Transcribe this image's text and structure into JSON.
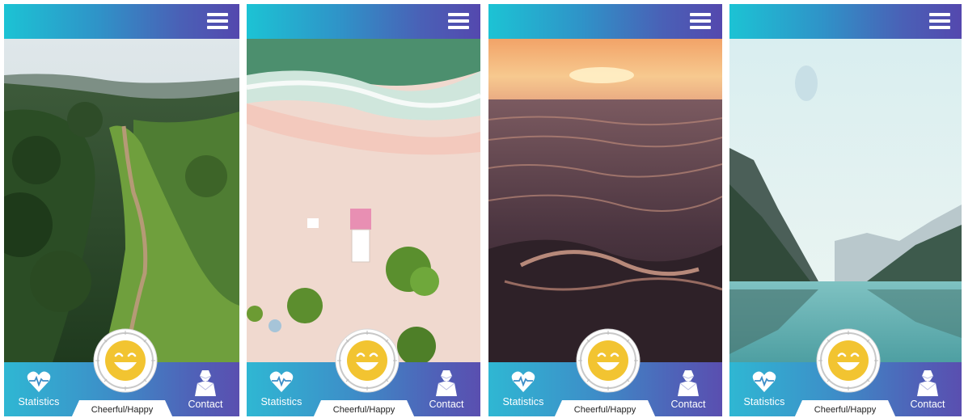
{
  "app": {
    "accent_gradient": [
      "#1cc3d4",
      "#5448ae"
    ],
    "face_color": "#f2c431"
  },
  "screens": [
    {
      "background": "forest ridge trail",
      "menu_icon": "hamburger-menu-icon",
      "nav": {
        "statistics_label": "Statistics",
        "contact_label": "Contact",
        "mood_label": "Cheerful/Happy"
      }
    },
    {
      "background": "aerial beach with lifeguard tower",
      "menu_icon": "hamburger-menu-icon",
      "nav": {
        "statistics_label": "Statistics",
        "contact_label": "Contact",
        "mood_label": "Cheerful/Happy"
      }
    },
    {
      "background": "ocean waves at sunset",
      "menu_icon": "hamburger-menu-icon",
      "nav": {
        "statistics_label": "Statistics",
        "contact_label": "Contact",
        "mood_label": "Cheerful/Happy"
      }
    },
    {
      "background": "mountain lake reflection",
      "menu_icon": "hamburger-menu-icon",
      "nav": {
        "statistics_label": "Statistics",
        "contact_label": "Contact",
        "mood_label": "Cheerful/Happy"
      }
    }
  ]
}
